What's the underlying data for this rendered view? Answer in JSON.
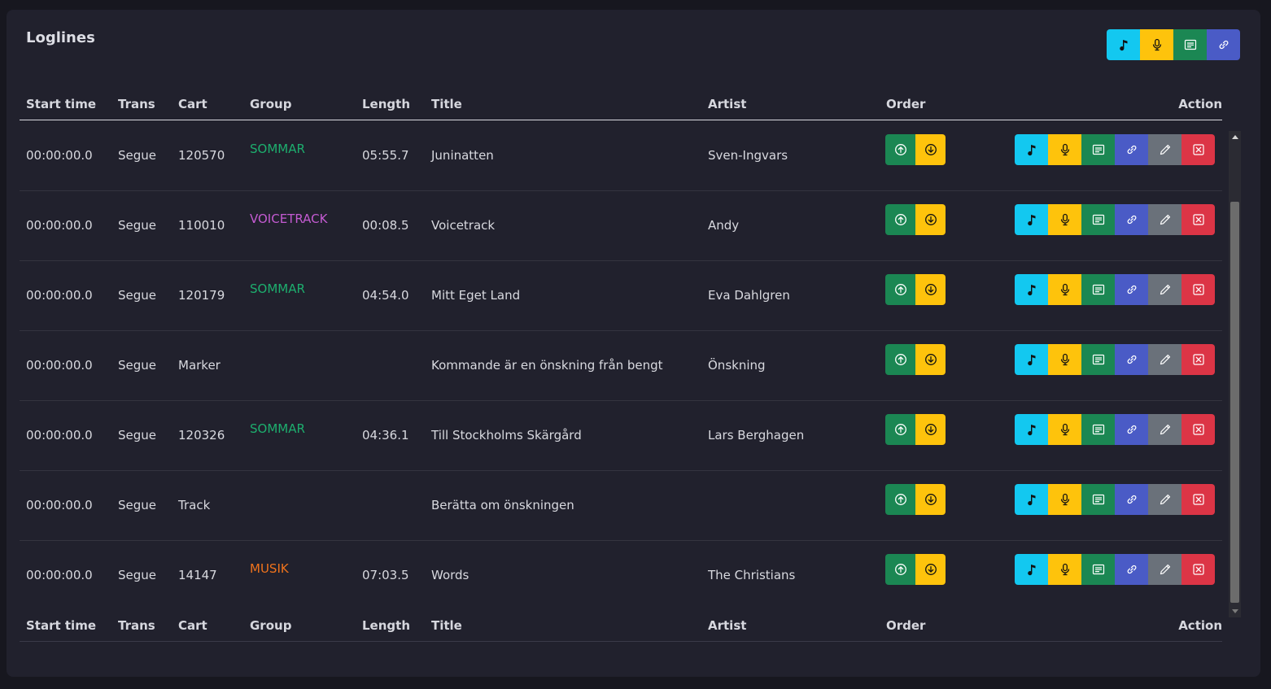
{
  "panel": {
    "title": "Loglines"
  },
  "colors": {
    "music": "#13c8f0",
    "voice": "#fec30c",
    "text": "#1b8753",
    "link": "#4a5bc6",
    "edit": "#6a717a",
    "delete": "#dc3546",
    "group_sommar": "#1dae6e",
    "group_voicetrack": "#c45bd2",
    "group_musik": "#f0731c"
  },
  "columns": {
    "start_time": "Start time",
    "trans": "Trans",
    "cart": "Cart",
    "group": "Group",
    "length": "Length",
    "title": "Title",
    "artist": "Artist",
    "order": "Order",
    "action": "Action"
  },
  "toolbar_icons": [
    "music-note-icon",
    "microphone-icon",
    "text-message-icon",
    "link-icon"
  ],
  "row_action_icons": [
    "music-note-icon",
    "microphone-icon",
    "text-message-icon",
    "link-icon",
    "pencil-icon",
    "close-x-icon"
  ],
  "order_icons": [
    "arrow-up-circle-icon",
    "arrow-down-circle-icon"
  ],
  "rows": [
    {
      "start": "00:00:00.0",
      "trans": "Segue",
      "cart": "120570",
      "group": "SOMMAR",
      "group_color": "#1dae6e",
      "length": "05:55.7",
      "title": "Juninatten",
      "artist": "Sven-Ingvars"
    },
    {
      "start": "00:00:00.0",
      "trans": "Segue",
      "cart": "110010",
      "group": "VOICETRACK",
      "group_color": "#c45bd2",
      "length": "00:08.5",
      "title": "Voicetrack",
      "artist": "Andy"
    },
    {
      "start": "00:00:00.0",
      "trans": "Segue",
      "cart": "120179",
      "group": "SOMMAR",
      "group_color": "#1dae6e",
      "length": "04:54.0",
      "title": "Mitt Eget Land",
      "artist": "Eva Dahlgren"
    },
    {
      "start": "00:00:00.0",
      "trans": "Segue",
      "cart": "Marker",
      "group": "",
      "group_color": "",
      "length": "",
      "title": "Kommande är en önskning från bengt",
      "artist": "Önskning"
    },
    {
      "start": "00:00:00.0",
      "trans": "Segue",
      "cart": "120326",
      "group": "SOMMAR",
      "group_color": "#1dae6e",
      "length": "04:36.1",
      "title": "Till Stockholms Skärgård",
      "artist": "Lars Berghagen"
    },
    {
      "start": "00:00:00.0",
      "trans": "Segue",
      "cart": "Track",
      "group": "",
      "group_color": "",
      "length": "",
      "title": "Berätta om önskningen",
      "artist": ""
    },
    {
      "start": "00:00:00.0",
      "trans": "Segue",
      "cart": "14147",
      "group": "MUSIK",
      "group_color": "#f0731c",
      "length": "07:03.5",
      "title": "Words",
      "artist": "The Christians"
    }
  ]
}
